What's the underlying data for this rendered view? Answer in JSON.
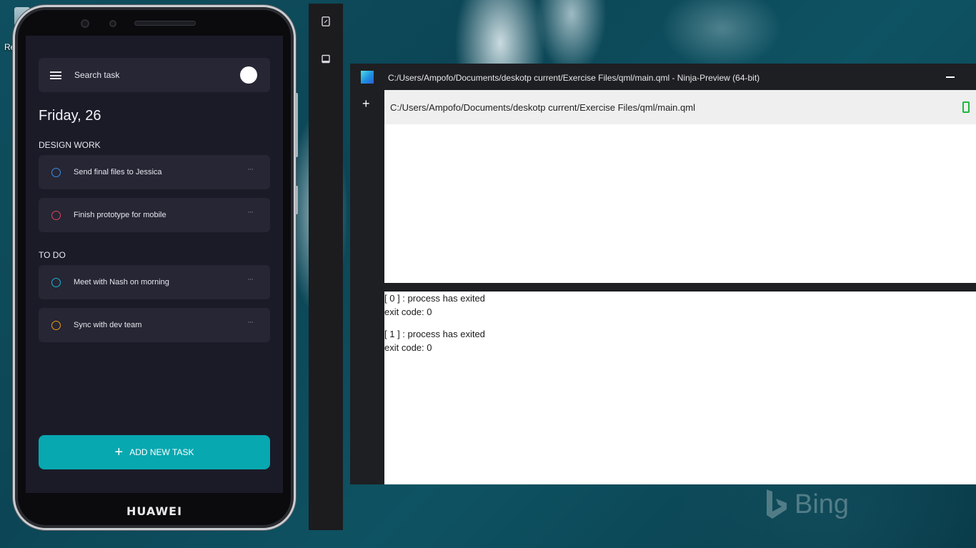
{
  "desktop": {
    "icon_label": "Re",
    "watermark": "Bing"
  },
  "phone": {
    "brand": "HUAWEI",
    "app": {
      "search_placeholder": "Search task",
      "date": "Friday, 26",
      "sections": [
        {
          "title": "DESIGN WORK",
          "tasks": [
            {
              "label": "Send final files to Jessica",
              "color": "#3a8ee6"
            },
            {
              "label": "Finish prototype for mobile",
              "color": "#e0455a"
            }
          ]
        },
        {
          "title": "TO DO",
          "tasks": [
            {
              "label": "Meet with Nash on morning",
              "color": "#1fb3d6"
            },
            {
              "label": "Sync with dev team",
              "color": "#f09a1a"
            }
          ]
        }
      ],
      "task_menu": "···",
      "add_button": "ADD NEW TASK",
      "accent": "#08a8b0"
    }
  },
  "preview_window": {
    "title": "C:/Users/Ampofo/Documents/deskotp current/Exercise Files/qml/main.qml  -  Ninja-Preview (64-bit)",
    "path": "C:/Users/Ampofo/Documents/deskotp current/Exercise Files/qml/main.qml",
    "add_label": "+",
    "console": [
      "[ 0 ] : process has exited",
      "exit code: 0",
      "[ 1 ] : process has exited",
      "exit code: 0"
    ]
  }
}
